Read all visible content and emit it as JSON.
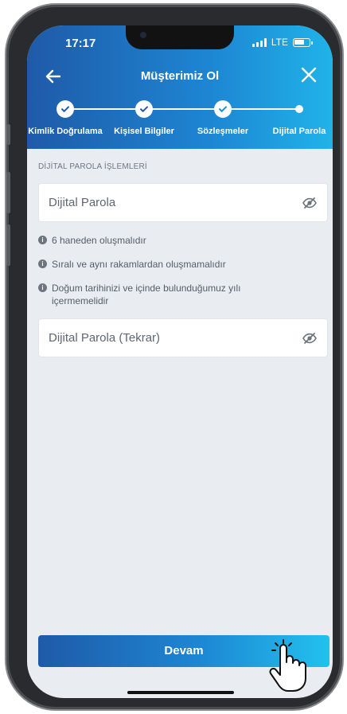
{
  "status": {
    "time": "17:17",
    "network": "LTE"
  },
  "header": {
    "title": "Müşterimiz Ol"
  },
  "steps": [
    {
      "label": "Kimlik Doğrulama",
      "state": "done"
    },
    {
      "label": "Kişisel Bilgiler",
      "state": "done"
    },
    {
      "label": "Sözleşmeler",
      "state": "done"
    },
    {
      "label": "Dijital Parola",
      "state": "current"
    }
  ],
  "form": {
    "section_label": "DİJİTAL PAROLA İŞLEMLERİ",
    "password_placeholder": "Dijital Parola",
    "password_repeat_placeholder": "Dijital Parola (Tekrar)",
    "hints": [
      "6 haneden oluşmalıdır",
      "Sıralı ve aynı rakamlardan oluşmamalıdır",
      "Doğum tarihinizi ve içinde bulunduğumuz yılı içermemelidir"
    ]
  },
  "cta": {
    "label": "Devam"
  },
  "colors": {
    "brand_dark": "#1f5aa8",
    "brand_light": "#22c1ee",
    "background": "#e9edf1"
  }
}
